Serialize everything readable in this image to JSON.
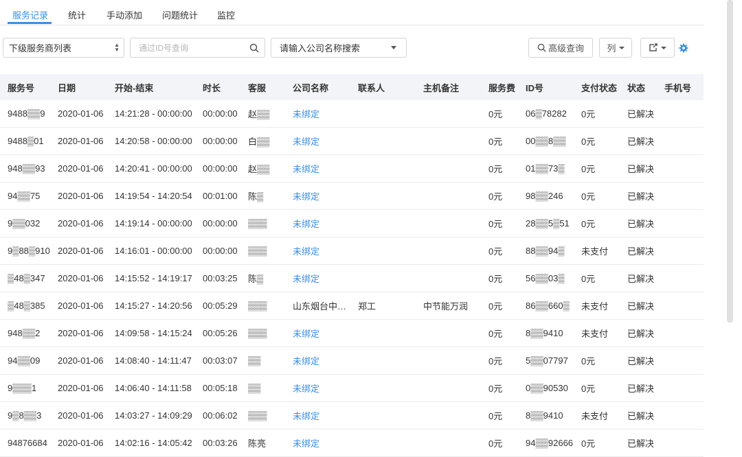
{
  "tabs": [
    {
      "label": "服务记录",
      "active": true
    },
    {
      "label": "统计",
      "active": false
    },
    {
      "label": "手动添加",
      "active": false
    },
    {
      "label": "问题统计",
      "active": false
    },
    {
      "label": "监控",
      "active": false
    }
  ],
  "filters": {
    "provider_select": "下级服务商列表",
    "id_search_placeholder": "通过ID号查询",
    "company_select": "请输入公司名称搜索",
    "advanced_query": "高级查询",
    "columns_button": "列",
    "export_icon": "share-icon",
    "settings_icon": "gear-icon"
  },
  "colors": {
    "accent": "#3a8ee6",
    "header_bg": "#f3f4f7"
  },
  "table": {
    "columns": [
      "服务号",
      "日期",
      "开始-结束",
      "时长",
      "客服",
      "公司名称",
      "联系人",
      "主机备注",
      "服务费",
      "ID号",
      "支付状态",
      "状态",
      "手机号"
    ],
    "rows": [
      {
        "service_no": "9488▒▒9",
        "date": "2020-01-06",
        "time_range": "14:21:28 - 00:00:00",
        "duration": "00:00:00",
        "agent": "赵▒▒",
        "company": "未绑定",
        "contact": "",
        "host_note": "",
        "fee": "0元",
        "id_no": "06▒78282",
        "pay_status": "0元",
        "status": "已解决",
        "phone": ""
      },
      {
        "service_no": "9488▒01",
        "date": "2020-01-06",
        "time_range": "14:20:58 - 00:00:00",
        "duration": "00:00:00",
        "agent": "白▒▒",
        "company": "未绑定",
        "contact": "",
        "host_note": "",
        "fee": "0元",
        "id_no": "00▒▒8▒▒",
        "pay_status": "0元",
        "status": "已解决",
        "phone": ""
      },
      {
        "service_no": "948▒▒93",
        "date": "2020-01-06",
        "time_range": "14:20:41 - 00:00:00",
        "duration": "00:00:00",
        "agent": "赵▒▒",
        "company": "未绑定",
        "contact": "",
        "host_note": "",
        "fee": "0元",
        "id_no": "01▒▒73▒",
        "pay_status": "0元",
        "status": "已解决",
        "phone": ""
      },
      {
        "service_no": "94▒▒75",
        "date": "2020-01-06",
        "time_range": "14:19:54 - 14:20:54",
        "duration": "00:01:00",
        "agent": "陈▒",
        "company": "未绑定",
        "contact": "",
        "host_note": "",
        "fee": "0元",
        "id_no": "98▒▒246",
        "pay_status": "0元",
        "status": "已解决",
        "phone": ""
      },
      {
        "service_no": "9▒▒032",
        "date": "2020-01-06",
        "time_range": "14:19:14 - 00:00:00",
        "duration": "00:00:00",
        "agent": "▒▒▒",
        "company": "未绑定",
        "contact": "",
        "host_note": "",
        "fee": "0元",
        "id_no": "28▒▒5▒51",
        "pay_status": "0元",
        "status": "已解决",
        "phone": ""
      },
      {
        "service_no": "9▒88▒910",
        "date": "2020-01-06",
        "time_range": "14:16:01 - 00:00:00",
        "duration": "00:00:00",
        "agent": "▒▒▒",
        "company": "未绑定",
        "contact": "",
        "host_note": "",
        "fee": "0元",
        "id_no": "88▒▒94▒",
        "pay_status": "未支付",
        "status": "已解决",
        "phone": ""
      },
      {
        "service_no": "▒48▒347",
        "date": "2020-01-06",
        "time_range": "14:15:52 - 14:19:17",
        "duration": "00:03:25",
        "agent": "陈▒",
        "company": "未绑定",
        "contact": "",
        "host_note": "",
        "fee": "0元",
        "id_no": "56▒▒03▒",
        "pay_status": "0元",
        "status": "已解决",
        "phone": ""
      },
      {
        "service_no": "▒48▒385",
        "date": "2020-01-06",
        "time_range": "14:15:27 - 14:20:56",
        "duration": "00:05:29",
        "agent": "▒▒▒",
        "company": "山东烟台中…",
        "contact": "郑工",
        "host_note": "中节能万润",
        "fee": "0元",
        "id_no": "86▒▒660▒",
        "pay_status": "未支付",
        "status": "已解决",
        "phone": ""
      },
      {
        "service_no": "948▒▒2",
        "date": "2020-01-06",
        "time_range": "14:09:58 - 14:15:24",
        "duration": "00:05:26",
        "agent": "▒▒▒",
        "company": "未绑定",
        "contact": "",
        "host_note": "",
        "fee": "0元",
        "id_no": "8▒▒9410",
        "pay_status": "未支付",
        "status": "已解决",
        "phone": ""
      },
      {
        "service_no": "94▒▒09",
        "date": "2020-01-06",
        "time_range": "14:08:40 - 14:11:47",
        "duration": "00:03:07",
        "agent": "▒▒",
        "company": "未绑定",
        "contact": "",
        "host_note": "",
        "fee": "0元",
        "id_no": "5▒▒07797",
        "pay_status": "0元",
        "status": "已解决",
        "phone": ""
      },
      {
        "service_no": "9▒▒▒1",
        "date": "2020-01-06",
        "time_range": "14:06:40 - 14:11:58",
        "duration": "00:05:18",
        "agent": "▒▒",
        "company": "未绑定",
        "contact": "",
        "host_note": "",
        "fee": "0元",
        "id_no": "0▒▒90530",
        "pay_status": "0元",
        "status": "已解决",
        "phone": ""
      },
      {
        "service_no": "9▒8▒▒3",
        "date": "2020-01-06",
        "time_range": "14:03:27 - 14:09:29",
        "duration": "00:06:02",
        "agent": "▒▒▒",
        "company": "未绑定",
        "contact": "",
        "host_note": "",
        "fee": "0元",
        "id_no": "8▒▒9410",
        "pay_status": "未支付",
        "status": "已解决",
        "phone": ""
      },
      {
        "service_no": "94876684",
        "date": "2020-01-06",
        "time_range": "14:02:16 - 14:05:42",
        "duration": "00:03:26",
        "agent": "陈亮",
        "company": "未绑定",
        "contact": "",
        "host_note": "",
        "fee": "0元",
        "id_no": "94▒▒92666",
        "pay_status": "0元",
        "status": "已解决",
        "phone": ""
      }
    ]
  }
}
